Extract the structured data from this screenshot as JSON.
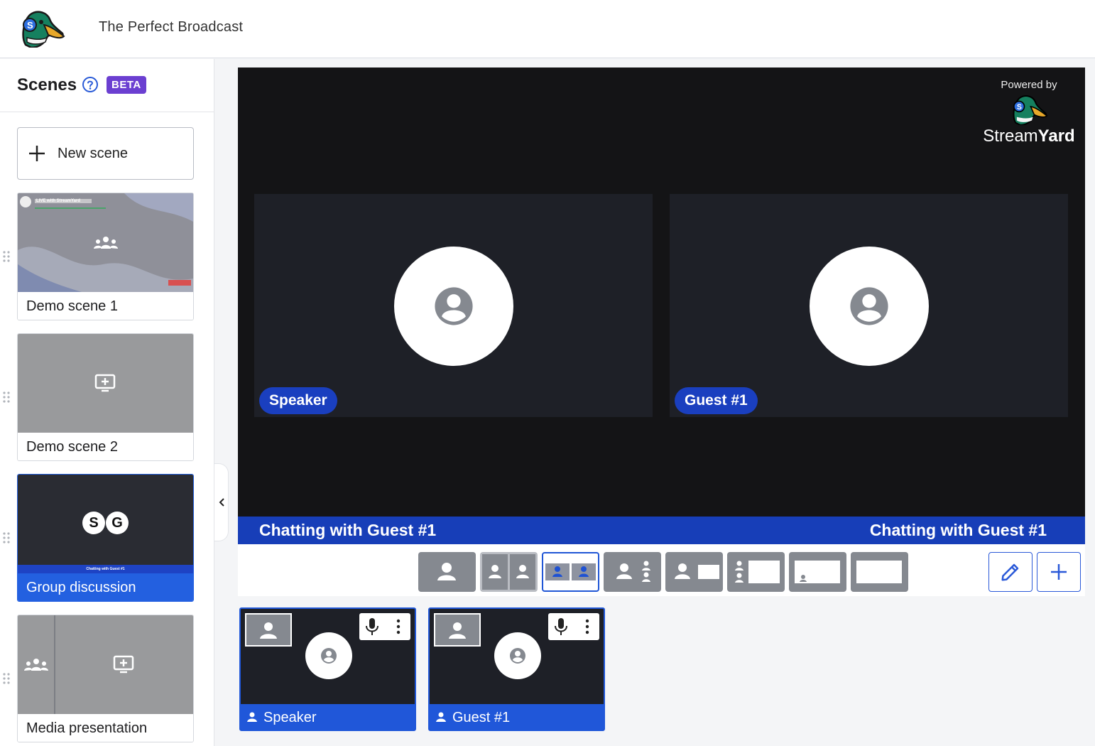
{
  "header": {
    "broadcast_title": "The Perfect Broadcast"
  },
  "sidebar": {
    "title": "Scenes",
    "beta_label": "BETA",
    "new_scene_label": "New scene",
    "scenes": [
      {
        "name": "Demo scene 1",
        "thumb_title": "LIVE with StreamYard",
        "active": false
      },
      {
        "name": "Demo scene 2",
        "active": false
      },
      {
        "name": "Group discussion",
        "active": true,
        "initials": [
          "S",
          "G"
        ],
        "thumb_banner": "Chatting with Guest #1"
      },
      {
        "name": "Media presentation",
        "active": false
      }
    ]
  },
  "stage": {
    "powered_by": "Powered by",
    "brand_light": "Stream",
    "brand_bold": "Yard",
    "tiles": [
      {
        "name": "Speaker"
      },
      {
        "name": "Guest #1"
      }
    ],
    "banner_left": "Chatting with Guest #1",
    "banner_right": "Chatting with Guest #1"
  },
  "layouts": {
    "selected_index": 2,
    "count": 8
  },
  "participants": [
    {
      "name": "Speaker"
    },
    {
      "name": "Guest #1"
    }
  ],
  "colors": {
    "accent": "#2057d9",
    "banner": "#173eb8",
    "beta": "#6b3fd1",
    "stage_bg": "#141416",
    "tile_bg": "#1e2027"
  },
  "icons": [
    "duck-logo",
    "help-icon",
    "plus-icon",
    "drag-handle-icon",
    "group-icon",
    "screen-share-icon",
    "chevron-left-icon",
    "person-icon",
    "pencil-icon",
    "mic-icon",
    "more-vertical-icon"
  ]
}
